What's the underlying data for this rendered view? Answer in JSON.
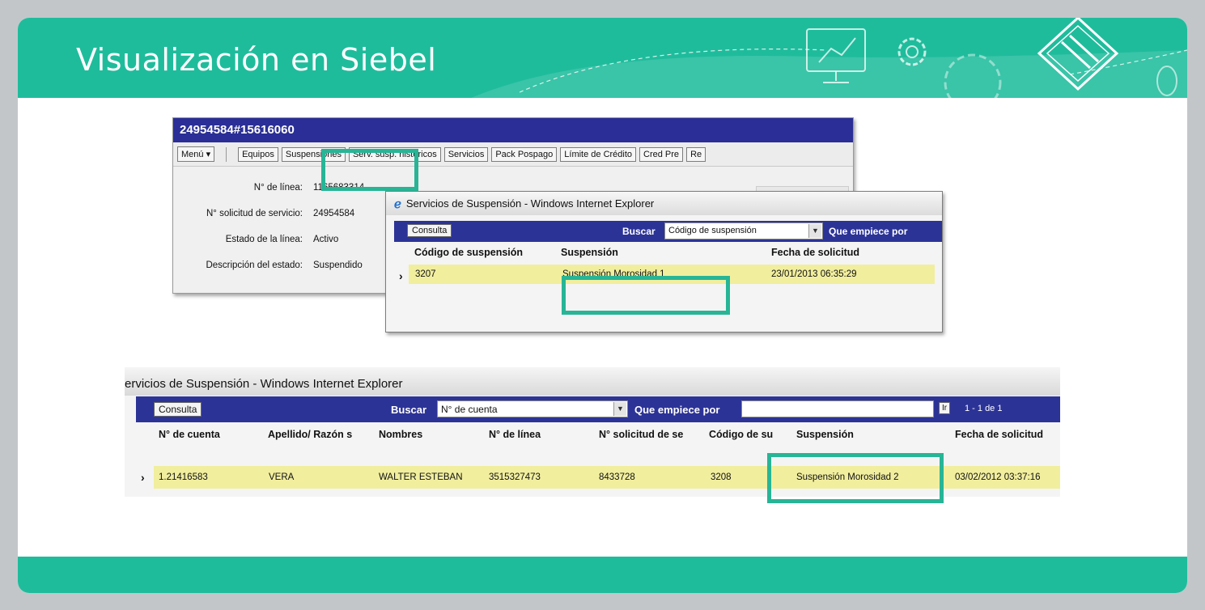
{
  "slide": {
    "title": "Visualización en Siebel"
  },
  "siebel": {
    "record_title": "24954584#15616060",
    "tabs": [
      "Menú ▾",
      "Equipos",
      "Suspensiones",
      "Serv. susp. históricos",
      "Servicios",
      "Pack Pospago",
      "Límite de Crédito",
      "Cred Pre",
      "Re"
    ],
    "fields": [
      {
        "label": "N° de línea:",
        "value": "1165683314"
      },
      {
        "label": "N° solicitud de servicio:",
        "value": "24954584"
      },
      {
        "label": "Estado de la línea:",
        "value": "Activo"
      },
      {
        "label": "Descripción del estado:",
        "value": "Suspendido"
      }
    ]
  },
  "popup1": {
    "window_title": "Servicios de Suspensión - Windows Internet Explorer",
    "consulta": "Consulta",
    "buscar": "Buscar",
    "select_value": "Código de suspensión",
    "que_empiece": "Que empiece por",
    "headers": [
      "Código de suspensión",
      "Suspensión",
      "Fecha de solicitud"
    ],
    "row": {
      "codigo": "3207",
      "suspension": "Suspensión Morosidad 1",
      "fecha": "23/01/2013 06:35:29"
    }
  },
  "popup2": {
    "window_title": "ervicios de Suspensión - Windows Internet Explorer",
    "consulta": "Consulta",
    "buscar": "Buscar",
    "select_value": "N° de cuenta",
    "que_empiece": "Que empiece por",
    "go": "Ir",
    "count": "1 - 1 de 1",
    "headers": [
      "N° de cuenta",
      "Apellido/ Razón s",
      "Nombres",
      "N° de línea",
      "N° solicitud de se",
      "Código de su",
      "Suspensión",
      "Fecha de solicitud"
    ],
    "row": [
      "1.21416583",
      "VERA",
      "WALTER ESTEBAN",
      "3515327473",
      "8433728",
      "3208",
      "Suspensión Morosidad 2",
      "03/02/2012 03:37:16"
    ]
  },
  "colors": {
    "accent": "#1fbc9c",
    "highlight": "#27b596",
    "siebel_bar": "#2a2e96",
    "row_yellow": "#f1ee9e"
  }
}
